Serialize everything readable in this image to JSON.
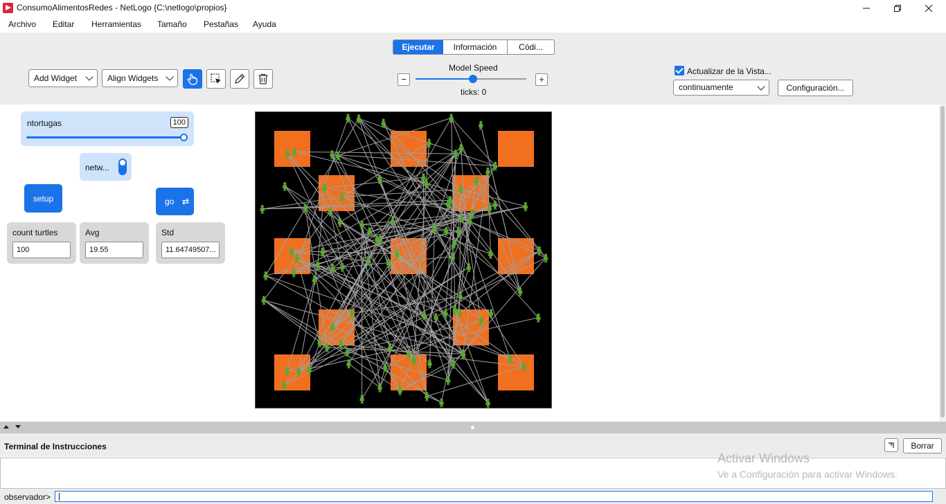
{
  "window": {
    "title": "ConsumoAlimentosRedes - NetLogo {C:\\netlogo\\propios}",
    "controls": [
      "minimize-icon",
      "restore-icon",
      "close-icon"
    ]
  },
  "menu": {
    "items": [
      "Archivo",
      "Editar",
      "Herramientas",
      "Tamaño",
      "Pestañas",
      "Ayuda"
    ]
  },
  "tabs": [
    "Ejecutar",
    "Información",
    "Códi..."
  ],
  "toolbar": {
    "add_widget": "Add Widget",
    "align_widgets": "Align Widgets",
    "tool_icons": [
      "hand-pointer-icon",
      "select-region-icon",
      "pencil-icon",
      "trash-icon"
    ],
    "model_speed_label": "Model Speed",
    "speed_fraction": 0.52,
    "speed_minus": "−",
    "speed_plus": "+",
    "ticks_text": "ticks: 0",
    "view_updates_label": "Actualizar de la Vista...",
    "view_updates_checked": true,
    "update_mode": "continuamente",
    "settings_button": "Configuración..."
  },
  "widgets": {
    "slider": {
      "name": "ntortugas",
      "value": "100",
      "fraction": 1.0
    },
    "switch": {
      "name": "netw...",
      "on": true
    },
    "setup_button": "setup",
    "go_button": "go",
    "monitors": [
      {
        "name": "count turtles",
        "value": "100"
      },
      {
        "name": "Avg",
        "value": "19.55"
      },
      {
        "name": "Std",
        "value": "11.64749507..."
      }
    ]
  },
  "world": {
    "background": "#000000",
    "patch_color": "#f07020",
    "turtle_color": "#5aa832",
    "link_color": "#a0a0a0",
    "turtle_count": 100
  },
  "terminal": {
    "title": "Terminal de Instrucciones",
    "clear_button": "Borrar",
    "prompt": "observador>"
  },
  "watermark": {
    "line1": "Activar Windows",
    "line2": "Ve a Configuración para activar Windows."
  },
  "colors": {
    "accent": "#1a73e8",
    "widget_bg": "#cfe3fb",
    "monitor_bg": "#d8d8d8",
    "toolbar_bg": "#ececec"
  }
}
